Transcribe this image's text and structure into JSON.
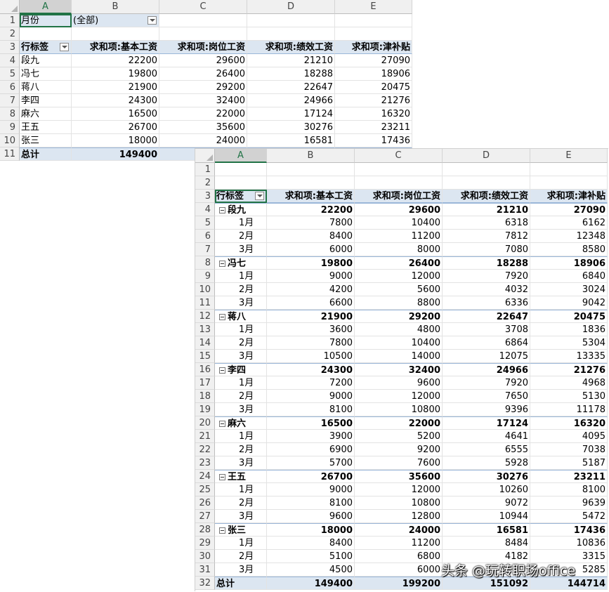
{
  "sheet1": {
    "columns": [
      "A",
      "B",
      "C",
      "D",
      "E"
    ],
    "rows": [
      "1",
      "2",
      "3",
      "4",
      "5",
      "6",
      "7",
      "8",
      "9",
      "10",
      "11"
    ],
    "filter_label": "月份",
    "filter_value": "(全部)",
    "headers": [
      "行标签",
      "求和项:基本工资",
      "求和项:岗位工资",
      "求和项:绩效工资",
      "求和项:津补贴"
    ],
    "data": [
      [
        "段九",
        "22200",
        "29600",
        "21210",
        "27090"
      ],
      [
        "冯七",
        "19800",
        "26400",
        "18288",
        "18906"
      ],
      [
        "蒋八",
        "21900",
        "29200",
        "22647",
        "20475"
      ],
      [
        "李四",
        "24300",
        "32400",
        "24966",
        "21276"
      ],
      [
        "麻六",
        "16500",
        "22000",
        "17124",
        "16320"
      ],
      [
        "王五",
        "26700",
        "35600",
        "30276",
        "23211"
      ],
      [
        "张三",
        "18000",
        "24000",
        "16581",
        "17436"
      ]
    ],
    "total_label": "总计",
    "total_b": "149400"
  },
  "sheet2": {
    "columns": [
      "A",
      "B",
      "C",
      "D",
      "E"
    ],
    "headers": [
      "行标签",
      "求和项:基本工资",
      "求和项:岗位工资",
      "求和项:绩效工资",
      "求和项:津补贴"
    ],
    "rows": [
      {
        "n": "1",
        "type": "blank",
        "cells": [
          "",
          "",
          "",
          "",
          ""
        ]
      },
      {
        "n": "2",
        "type": "blank",
        "cells": [
          "",
          "",
          "",
          "",
          ""
        ]
      },
      {
        "n": "4",
        "type": "group",
        "cells": [
          "段九",
          "22200",
          "29600",
          "21210",
          "27090"
        ]
      },
      {
        "n": "5",
        "type": "item",
        "cells": [
          "1月",
          "7800",
          "10400",
          "6318",
          "6162"
        ]
      },
      {
        "n": "6",
        "type": "item",
        "cells": [
          "2月",
          "8400",
          "11200",
          "7812",
          "12348"
        ]
      },
      {
        "n": "7",
        "type": "item",
        "cells": [
          "3月",
          "6000",
          "8000",
          "7080",
          "8580"
        ]
      },
      {
        "n": "8",
        "type": "group",
        "cells": [
          "冯七",
          "19800",
          "26400",
          "18288",
          "18906"
        ]
      },
      {
        "n": "9",
        "type": "item",
        "cells": [
          "1月",
          "9000",
          "12000",
          "7920",
          "6840"
        ]
      },
      {
        "n": "10",
        "type": "item",
        "cells": [
          "2月",
          "4200",
          "5600",
          "4032",
          "3024"
        ]
      },
      {
        "n": "11",
        "type": "item",
        "cells": [
          "3月",
          "6600",
          "8800",
          "6336",
          "9042"
        ]
      },
      {
        "n": "12",
        "type": "group",
        "cells": [
          "蒋八",
          "21900",
          "29200",
          "22647",
          "20475"
        ]
      },
      {
        "n": "13",
        "type": "item",
        "cells": [
          "1月",
          "3600",
          "4800",
          "3708",
          "1836"
        ]
      },
      {
        "n": "14",
        "type": "item",
        "cells": [
          "2月",
          "7800",
          "10400",
          "6864",
          "5304"
        ]
      },
      {
        "n": "15",
        "type": "item",
        "cells": [
          "3月",
          "10500",
          "14000",
          "12075",
          "13335"
        ]
      },
      {
        "n": "16",
        "type": "group",
        "cells": [
          "李四",
          "24300",
          "32400",
          "24966",
          "21276"
        ]
      },
      {
        "n": "17",
        "type": "item",
        "cells": [
          "1月",
          "7200",
          "9600",
          "7920",
          "4968"
        ]
      },
      {
        "n": "18",
        "type": "item",
        "cells": [
          "2月",
          "9000",
          "12000",
          "7650",
          "5130"
        ]
      },
      {
        "n": "19",
        "type": "item",
        "cells": [
          "3月",
          "8100",
          "10800",
          "9396",
          "11178"
        ]
      },
      {
        "n": "20",
        "type": "group",
        "cells": [
          "麻六",
          "16500",
          "22000",
          "17124",
          "16320"
        ]
      },
      {
        "n": "21",
        "type": "item",
        "cells": [
          "1月",
          "3900",
          "5200",
          "4641",
          "4095"
        ]
      },
      {
        "n": "22",
        "type": "item",
        "cells": [
          "2月",
          "6900",
          "9200",
          "6555",
          "7038"
        ]
      },
      {
        "n": "23",
        "type": "item",
        "cells": [
          "3月",
          "5700",
          "7600",
          "5928",
          "5187"
        ]
      },
      {
        "n": "24",
        "type": "group",
        "cells": [
          "王五",
          "26700",
          "35600",
          "30276",
          "23211"
        ]
      },
      {
        "n": "25",
        "type": "item",
        "cells": [
          "1月",
          "9000",
          "12000",
          "10260",
          "8100"
        ]
      },
      {
        "n": "26",
        "type": "item",
        "cells": [
          "2月",
          "8100",
          "10800",
          "9072",
          "9639"
        ]
      },
      {
        "n": "27",
        "type": "item",
        "cells": [
          "3月",
          "9600",
          "12800",
          "10944",
          "5472"
        ]
      },
      {
        "n": "28",
        "type": "group",
        "cells": [
          "张三",
          "18000",
          "24000",
          "16581",
          "17436"
        ]
      },
      {
        "n": "29",
        "type": "item",
        "cells": [
          "1月",
          "8400",
          "11200",
          "8484",
          "10836"
        ]
      },
      {
        "n": "30",
        "type": "item",
        "cells": [
          "2月",
          "5100",
          "6800",
          "4182",
          "3315"
        ]
      },
      {
        "n": "31",
        "type": "item",
        "cells": [
          "3月",
          "4500",
          "6000",
          "",
          "5285"
        ]
      },
      {
        "n": "32",
        "type": "total",
        "cells": [
          "总计",
          "149400",
          "199200",
          "151092",
          "144714"
        ]
      }
    ],
    "header_row_num": "3"
  },
  "watermark": "头条 @玩转职场office"
}
